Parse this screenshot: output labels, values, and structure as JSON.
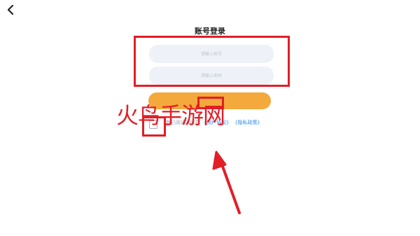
{
  "page": {
    "title": "账号登录"
  },
  "form": {
    "account_placeholder": "请输入账号",
    "password_placeholder": "请输入密码",
    "login_label": ""
  },
  "agreement": {
    "prefix": "我已阅读并同意",
    "user_agreement": "《用户协议》",
    "privacy_policy": "《隐私政策》"
  },
  "watermark": {
    "text": "火鸟手游网"
  },
  "colors": {
    "accent": "#f4a93c",
    "link": "#2d8cf0",
    "annotation": "#e21e27",
    "input_bg": "#eef2f8"
  },
  "icons": {
    "back": "chevron-left-icon"
  }
}
